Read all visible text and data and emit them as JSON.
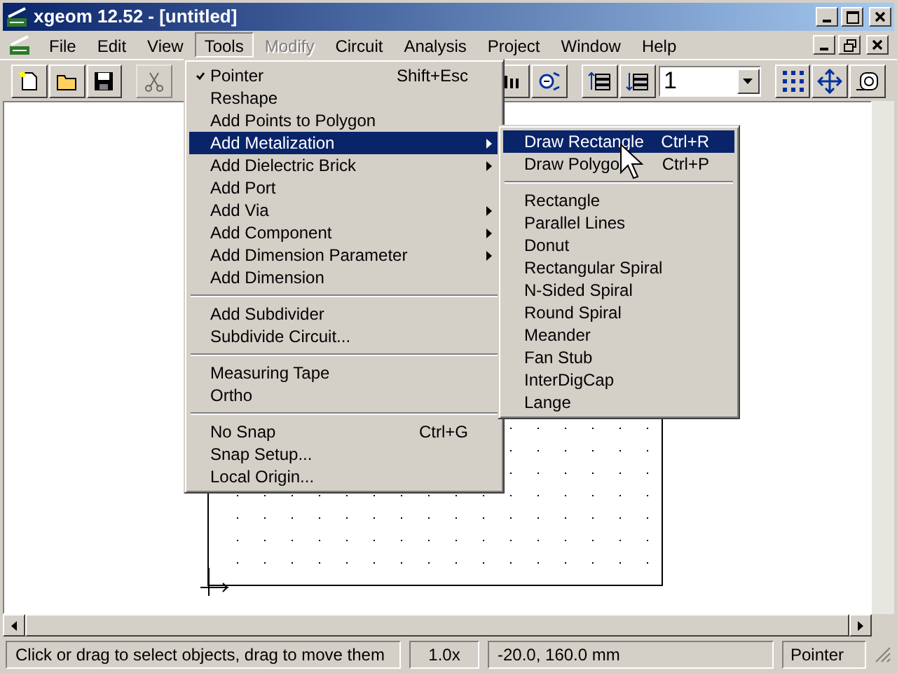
{
  "window": {
    "title": "xgeom 12.52 - [untitled]"
  },
  "menu_bar": [
    {
      "label": "File",
      "selected": false,
      "disabled": false
    },
    {
      "label": "Edit",
      "selected": false,
      "disabled": false
    },
    {
      "label": "View",
      "selected": false,
      "disabled": false
    },
    {
      "label": "Tools",
      "selected": true,
      "disabled": false
    },
    {
      "label": "Modify",
      "selected": false,
      "disabled": true
    },
    {
      "label": "Circuit",
      "selected": false,
      "disabled": false
    },
    {
      "label": "Analysis",
      "selected": false,
      "disabled": false
    },
    {
      "label": "Project",
      "selected": false,
      "disabled": false
    },
    {
      "label": "Window",
      "selected": false,
      "disabled": false
    },
    {
      "label": "Help",
      "selected": false,
      "disabled": false
    }
  ],
  "toolbar": {
    "layer_combo": {
      "value": "1"
    }
  },
  "tools_menu": {
    "groups": [
      [
        {
          "label": "Pointer",
          "shortcut": "Shift+Esc",
          "checked": true,
          "submenu": false,
          "selected": false
        },
        {
          "label": "Reshape",
          "checked": false,
          "submenu": false,
          "selected": false
        },
        {
          "label": "Add Points to Polygon",
          "checked": false,
          "submenu": false,
          "selected": false
        },
        {
          "label": "Add Metalization",
          "checked": false,
          "submenu": true,
          "selected": true
        },
        {
          "label": "Add Dielectric Brick",
          "checked": false,
          "submenu": true,
          "selected": false
        },
        {
          "label": "Add Port",
          "checked": false,
          "submenu": false,
          "selected": false
        },
        {
          "label": "Add Via",
          "checked": false,
          "submenu": true,
          "selected": false
        },
        {
          "label": "Add Component",
          "checked": false,
          "submenu": true,
          "selected": false
        },
        {
          "label": "Add Dimension Parameter",
          "checked": false,
          "submenu": true,
          "selected": false
        },
        {
          "label": "Add Dimension",
          "checked": false,
          "submenu": false,
          "selected": false
        }
      ],
      [
        {
          "label": "Add Subdivider",
          "checked": false,
          "submenu": false,
          "selected": false
        },
        {
          "label": "Subdivide Circuit...",
          "checked": false,
          "submenu": false,
          "selected": false
        }
      ],
      [
        {
          "label": "Measuring Tape",
          "checked": false,
          "submenu": false,
          "selected": false
        },
        {
          "label": "Ortho",
          "checked": false,
          "submenu": false,
          "selected": false
        }
      ],
      [
        {
          "label": "No Snap",
          "shortcut": "Ctrl+G",
          "checked": false,
          "submenu": false,
          "selected": false
        },
        {
          "label": "Snap Setup...",
          "checked": false,
          "submenu": false,
          "selected": false
        },
        {
          "label": "Local Origin...",
          "checked": false,
          "submenu": false,
          "selected": false
        }
      ]
    ]
  },
  "metalization_submenu": {
    "groups": [
      [
        {
          "label": "Draw Rectangle",
          "shortcut": "Ctrl+R",
          "selected": true
        },
        {
          "label": "Draw Polygo",
          "shortcut": "Ctrl+P",
          "selected": false
        }
      ],
      [
        {
          "label": "Rectangle",
          "selected": false
        },
        {
          "label": "Parallel Lines",
          "selected": false
        },
        {
          "label": "Donut",
          "selected": false
        },
        {
          "label": "Rectangular Spiral",
          "selected": false
        },
        {
          "label": "N-Sided Spiral",
          "selected": false
        },
        {
          "label": "Round Spiral",
          "selected": false
        },
        {
          "label": "Meander",
          "selected": false
        },
        {
          "label": "Fan Stub",
          "selected": false
        },
        {
          "label": "InterDigCap",
          "selected": false
        },
        {
          "label": "Lange",
          "selected": false
        }
      ]
    ]
  },
  "status_bar": {
    "message": "Click or drag to select objects, drag to move them",
    "zoom": "1.0x",
    "coordinates": "-20.0, 160.0 mm",
    "mode": "Pointer"
  }
}
